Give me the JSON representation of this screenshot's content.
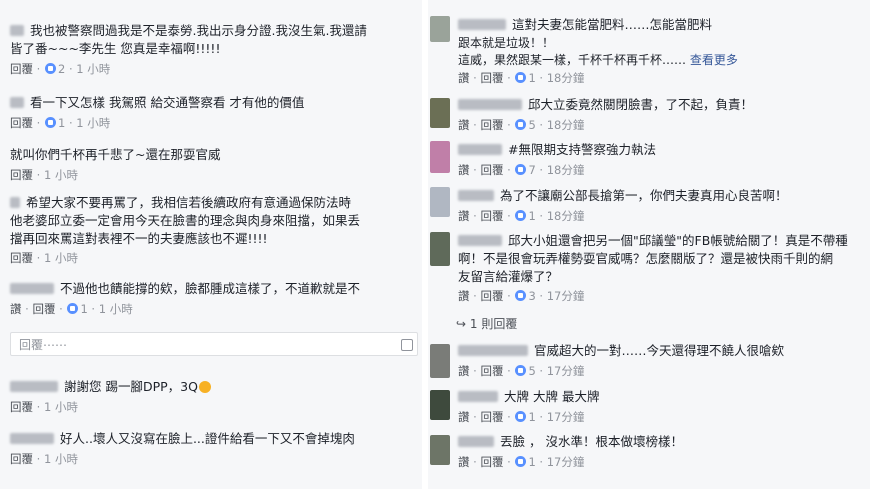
{
  "left": {
    "comments": [
      {
        "lines": [
          "我也被警察問過我是不是泰勞.我出示身分證.我沒生氣.我還請",
          "皆了番~~~李先生 您真是幸福啊!!!!!"
        ],
        "reply": "回覆",
        "reacts": "2",
        "time": "1 小時"
      },
      {
        "lines": [
          "看一下又怎樣 我駕照 給交通警察看 才有他的價值"
        ],
        "reply": "回覆",
        "reacts": "1",
        "time": "1 小時"
      },
      {
        "lines": [
          "就叫你們千杯再千悲了~還在那耍官威"
        ],
        "reply": "回覆",
        "reacts": null,
        "time": "1 小時"
      },
      {
        "lines": [
          "希望大家不要再罵了，我相信若後續政府有意通過保防法時",
          "他老婆邱立委一定會用今天在臉書的理念與肉身來阻擋，如果丢",
          "擋再回來罵這對表裡不一的夫妻應該也不遲!!!!"
        ],
        "reply": "回覆",
        "reacts": null,
        "time": "1 小時"
      },
      {
        "lines": [
          "不過他也饋能撐的欸，臉都腫成這樣了，不道歉就是不"
        ],
        "like": "讚",
        "reply": "回覆",
        "reacts": "1",
        "time": "1 小時"
      },
      {
        "lines": [
          "謝謝您 踢一腳DPP，3Q"
        ],
        "reply": "回覆",
        "reacts": null,
        "time": "1 小時"
      },
      {
        "lines": [
          "好人..壞人又沒寫在臉上...證件給看一下又不會掉塊肉"
        ],
        "reply": "回覆",
        "reacts": null,
        "time": "1 小時"
      }
    ],
    "reply_placeholder": "回覆⋯⋯"
  },
  "right": {
    "comments": [
      {
        "lines": [
          "這對夫妻怎能當肥料……怎能當肥料",
          "跟本就是垃圾！！",
          "這威，果然跟某一樣，千杯千杯再千杯…… "
        ],
        "see_more": "查看更多",
        "like": "讚",
        "reply": "回覆",
        "reacts": "1",
        "time": "18分鐘"
      },
      {
        "lines": [
          "邱大立委竟然關閉臉書，了不起，負責！"
        ],
        "like": "讚",
        "reply": "回覆",
        "reacts": "5",
        "time": "18分鐘"
      },
      {
        "lines": [
          "#無限期支持警察強力執法"
        ],
        "like": "讚",
        "reply": "回覆",
        "reacts": "7",
        "time": "18分鐘"
      },
      {
        "lines": [
          "為了不讓廟公部長搶第一，你們夫妻真用心良苦啊！"
        ],
        "like": "讚",
        "reply": "回覆",
        "reacts": "1",
        "time": "18分鐘"
      },
      {
        "lines": [
          "邱大小姐還會把另一個\"邱議瑩\"的FB帳號給關了！真是不帶種",
          "啊！不是很會玩弄權勢耍官威嗎？怎麼關版了？還是被快雨千則的網",
          "友留言給灌爆了？"
        ],
        "like": "讚",
        "reply": "回覆",
        "reacts": "3",
        "time": "17分鐘"
      },
      {
        "lines": [
          "官威超大的一對……今天還得理不饒人很嗆欸"
        ],
        "like": "讚",
        "reply": "回覆",
        "reacts": "5",
        "time": "17分鐘"
      },
      {
        "lines": [
          "大牌 大牌 最大牌"
        ],
        "like": "讚",
        "reply": "回覆",
        "reacts": "1",
        "time": "17分鐘"
      },
      {
        "lines": [
          "丟臉 ， 沒水準！根本做壞榜樣！"
        ],
        "like": "讚",
        "reply": "回覆",
        "reacts": "1",
        "time": "17分鐘"
      }
    ],
    "replies_link": "1 則回覆"
  }
}
